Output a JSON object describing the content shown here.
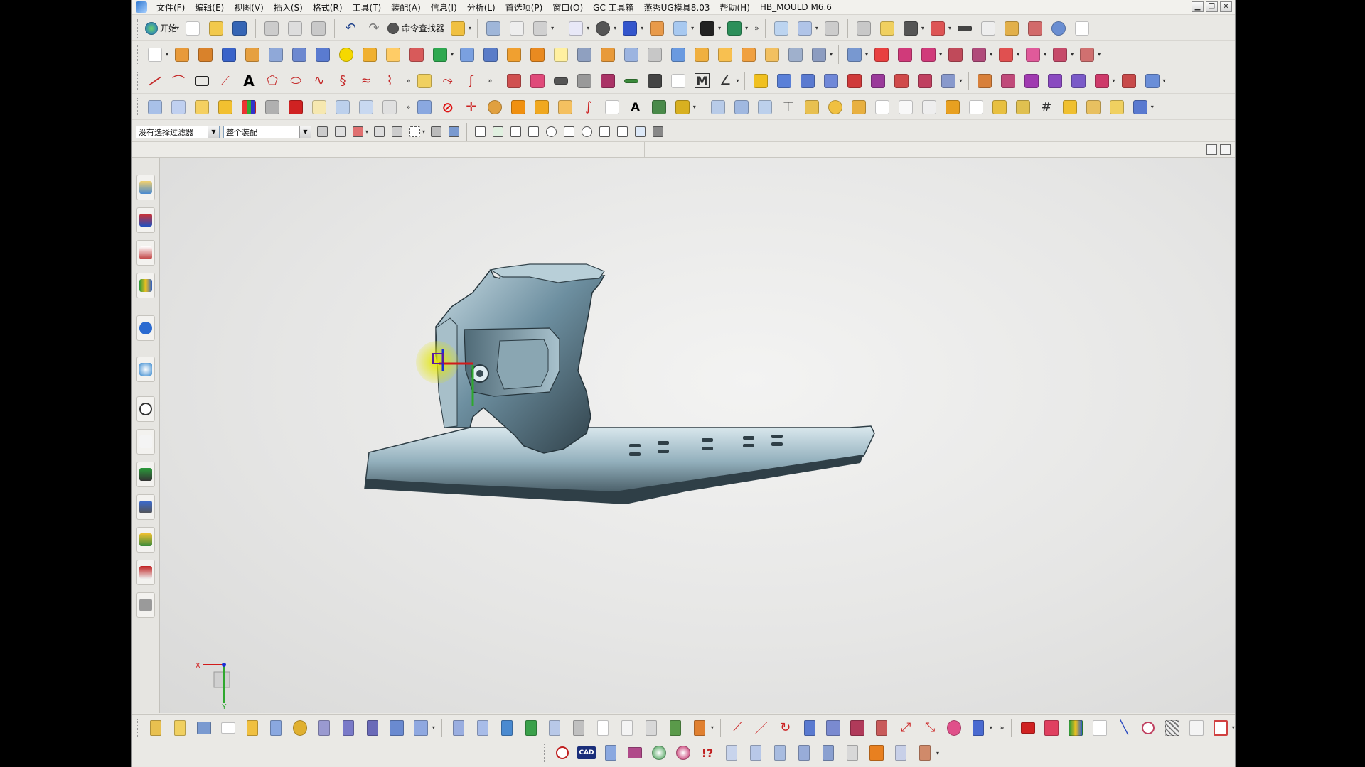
{
  "menubar": {
    "items": [
      "文件(F)",
      "编辑(E)",
      "视图(V)",
      "插入(S)",
      "格式(R)",
      "工具(T)",
      "装配(A)",
      "信息(I)",
      "分析(L)",
      "首选项(P)",
      "窗口(O)",
      "GC 工具箱",
      "燕秀UG模具8.03",
      "帮助(H)",
      "HB_MOULD M6.6"
    ]
  },
  "toolbar": {
    "start_label": "开始",
    "command_finder_label": "命令查找器"
  },
  "selection_bar": {
    "filter_value": "没有选择过滤器",
    "scope_value": "整个装配"
  },
  "triad": {
    "x_label": "X",
    "y_label": "Y"
  },
  "colors": {
    "part_face": "#6d8fa0",
    "part_light": "#c8dbe3",
    "part_dark": "#2d3d45",
    "csys_origin": "#e3e600",
    "csys_x": "#d11b1b",
    "csys_y": "#2ea82e",
    "csys_z": "#1a2fd6"
  },
  "icons": {
    "window_minimize": "minimize-icon",
    "window_restore": "restore-icon",
    "window_close": "close-icon"
  }
}
